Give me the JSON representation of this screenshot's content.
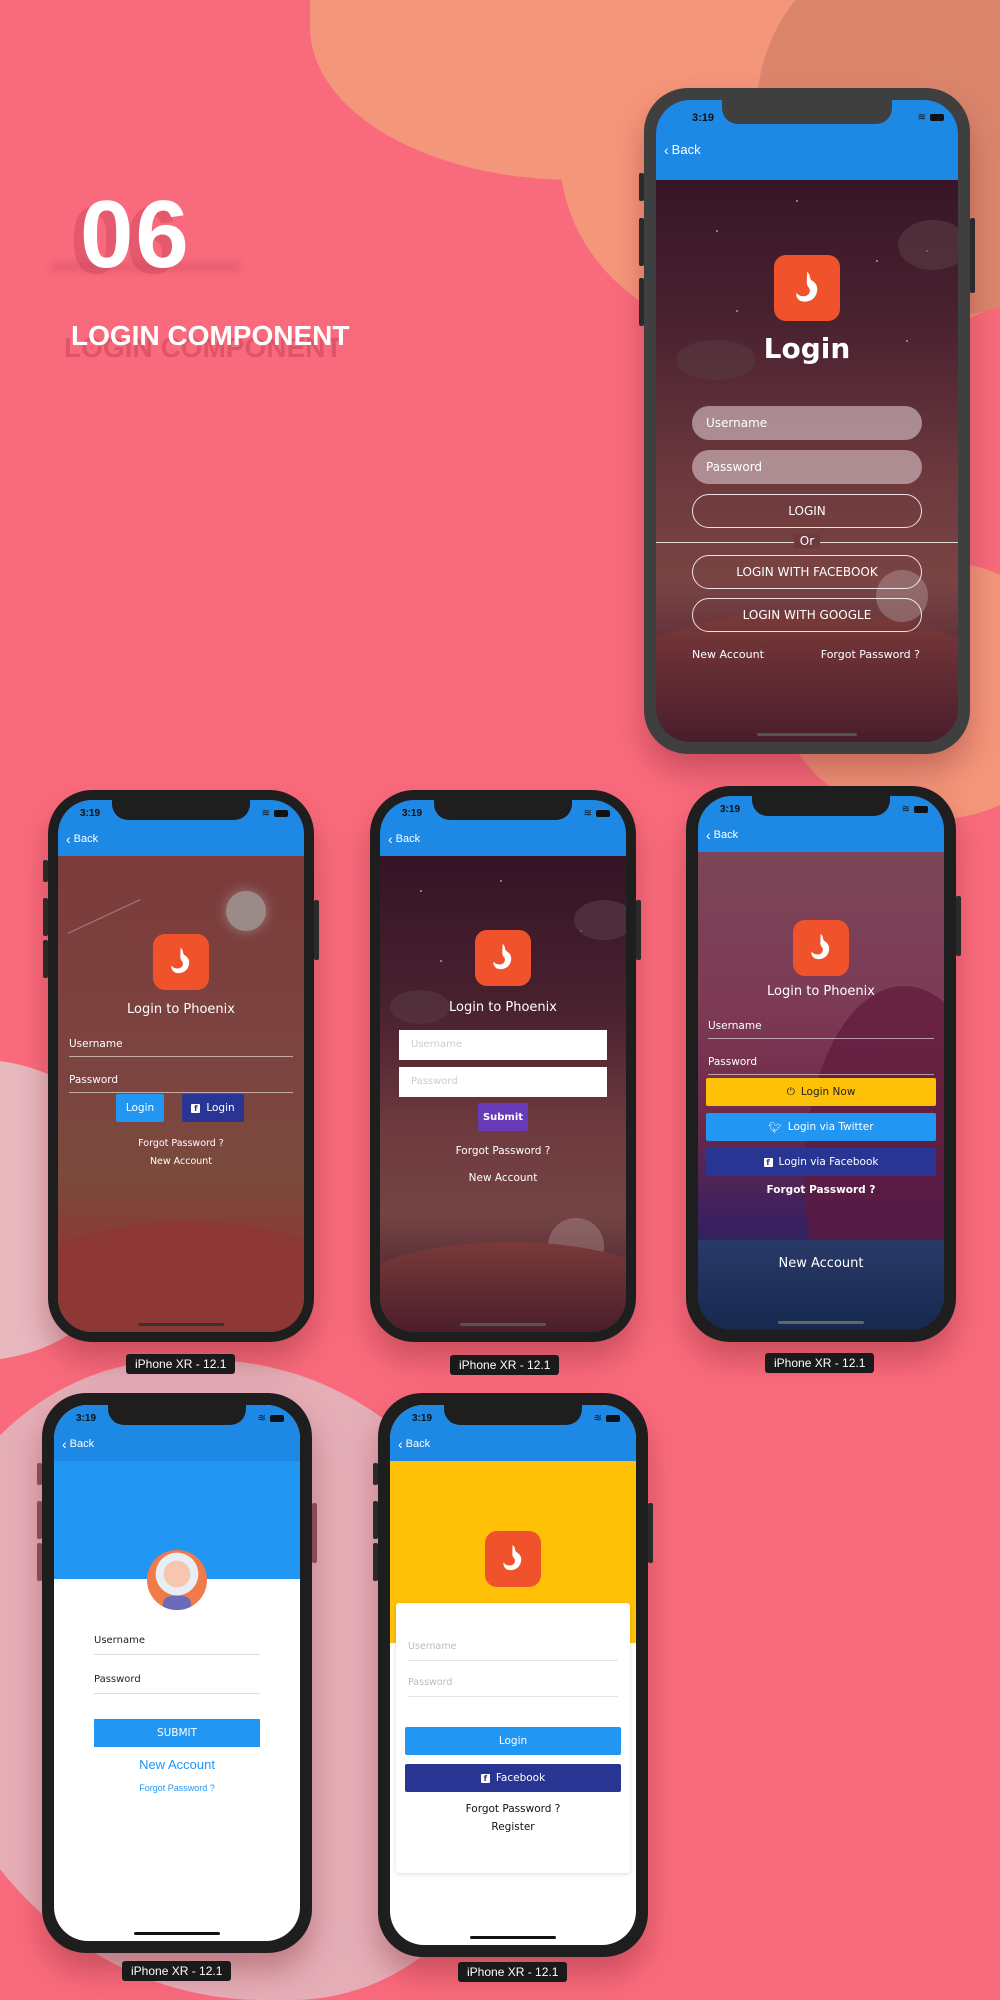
{
  "heading": {
    "number": "06",
    "title": "LOGIN COMPONENT"
  },
  "colors": {
    "background": "#f96b7c",
    "topbar": "#1e88e5",
    "logo": "#f0522b",
    "yellow": "#ffc107",
    "twitter": "#2196f3",
    "facebook": "#283593",
    "submit_purple": "#673ab7"
  },
  "status_bar": {
    "time": "3:19"
  },
  "nav": {
    "back_label": "Back"
  },
  "device_label": "iPhone XR - 12.1",
  "screens": {
    "hero": {
      "title": "Login",
      "username_placeholder": "Username",
      "password_placeholder": "Password",
      "login_button": "LOGIN",
      "divider": "Or",
      "facebook_button": "LOGIN WITH FACEBOOK",
      "google_button": "LOGIN WITH GOOGLE",
      "new_account": "New Account",
      "forgot_password": "Forgot Password ?"
    },
    "phoenix_sunset": {
      "title": "Login to Phoenix",
      "username_label": "Username",
      "password_label": "Password",
      "login_button": "Login",
      "facebook_login_button": "Login",
      "forgot_password": "Forgot Password ?",
      "new_account": "New Account"
    },
    "phoenix_night": {
      "title": "Login to Phoenix",
      "username_placeholder": "Username",
      "password_placeholder": "Password",
      "submit_button": "Submit",
      "forgot_password": "Forgot Password ?",
      "new_account": "New Account"
    },
    "phoenix_purple": {
      "title": "Login to Phoenix",
      "username_label": "Username",
      "password_label": "Password",
      "login_now_button": "Login Now",
      "twitter_button": "Login via Twitter",
      "facebook_button": "Login via Facebook",
      "forgot_password": "Forgot Password ?",
      "new_account": "New Account"
    },
    "avatar_login": {
      "username_label": "Username",
      "password_label": "Password",
      "submit_button": "SUBMIT",
      "new_account": "New Account",
      "forgot_password": "Forgot Password ?"
    },
    "yellow_card": {
      "username_placeholder": "Username",
      "password_placeholder": "Password",
      "login_button": "Login",
      "facebook_button": "Facebook",
      "forgot_password": "Forgot Password ?",
      "register": "Register"
    }
  }
}
